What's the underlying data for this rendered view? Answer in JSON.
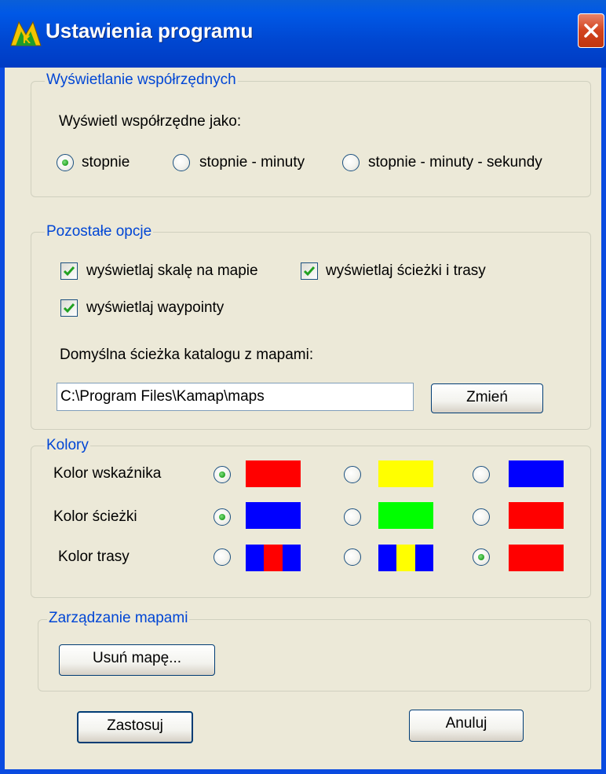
{
  "window": {
    "title": "Ustawienia programu"
  },
  "coords": {
    "legend": "Wyświetlanie współrzędnych",
    "prompt": "Wyświetl współrzędne jako:",
    "options": [
      "stopnie",
      "stopnie - minuty",
      "stopnie - minuty - sekundy"
    ],
    "selected": "stopnie"
  },
  "other": {
    "legend": "Pozostałe opcje",
    "checkboxes": [
      {
        "label": "wyświetlaj skalę na mapie",
        "checked": true
      },
      {
        "label": "wyświetlaj ścieżki i trasy",
        "checked": true
      },
      {
        "label": "wyświetlaj waypointy",
        "checked": true
      }
    ],
    "path_label": "Domyślna ścieżka katalogu z mapami:",
    "path_value": "C:\\Program Files\\Kamap\\maps",
    "change_button": "Zmień"
  },
  "colors": {
    "legend": "Kolory",
    "rows": [
      {
        "label": "Kolor wskaźnika",
        "selected_index": 0,
        "swatches": [
          [
            "#ff0000"
          ],
          [
            "#ffff00"
          ],
          [
            "#0000ff"
          ]
        ]
      },
      {
        "label": "Kolor ścieżki",
        "selected_index": 0,
        "swatches": [
          [
            "#0000ff"
          ],
          [
            "#00ff00"
          ],
          [
            "#ff0000"
          ]
        ]
      },
      {
        "label": "Kolor trasy",
        "selected_index": 2,
        "swatches": [
          [
            "#0000ff",
            "#ff0000",
            "#0000ff"
          ],
          [
            "#0000ff",
            "#ffff00",
            "#0000ff"
          ],
          [
            "#ff0000"
          ]
        ]
      }
    ]
  },
  "maps": {
    "legend": "Zarządzanie mapami",
    "delete_button": "Usuń mapę..."
  },
  "footer": {
    "apply_button": "Zastosuj",
    "cancel_button": "Anuluj"
  }
}
